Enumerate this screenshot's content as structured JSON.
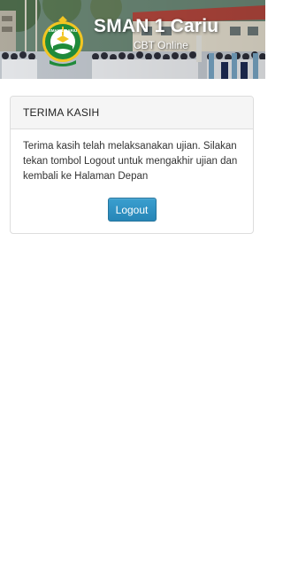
{
  "header": {
    "school_name": "SMAN 1 Cariu",
    "subtitle": "CBT Online",
    "logo": {
      "icon": "school-crest-icon",
      "text": "SMAN 1 CARIU"
    }
  },
  "panel": {
    "title": "TERIMA KASIH",
    "message": "Terima kasih telah melaksanakan ujian. Silakan tekan tombol Logout untuk mengakhir ujian dan kembali ke Halaman Depan",
    "logout_label": "Logout"
  },
  "colors": {
    "button": "#2786b7",
    "panel_heading_bg": "#f5f5f5",
    "border": "#dddddd",
    "logo_green": "#1f8a3a",
    "logo_yellow": "#f2c522"
  }
}
